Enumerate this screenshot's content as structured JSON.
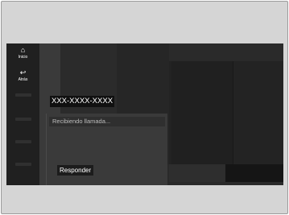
{
  "nav": {
    "home": {
      "icon": "home-icon",
      "glyph": "⌂",
      "label": "Inicio"
    },
    "back": {
      "icon": "back-icon",
      "glyph": "↩",
      "label": "Atrás"
    }
  },
  "call": {
    "number": "XXX-XXXX-XXXX",
    "status": "Recibiendo llamada...",
    "answer_label": "Responder"
  }
}
